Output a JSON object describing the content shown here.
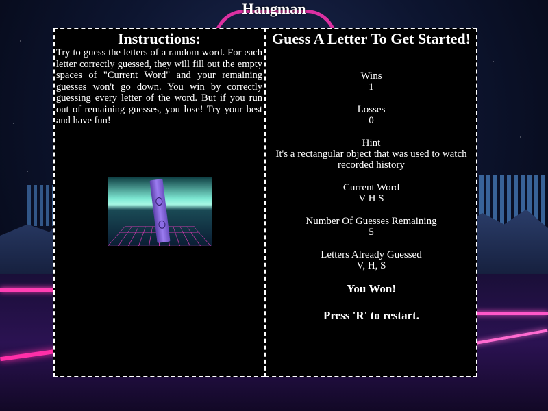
{
  "header": {
    "title": "Hangman"
  },
  "instructions": {
    "title": "Instructions:",
    "body": "Try to guess the letters of a random word. For each letter correctly guessed, they will fill out the empty spaces of \"Current Word\" and your remaining guesses won't go down. You win by correctly guessing every letter of the word. But if you run out of remaining guesses, you lose! Try your best and have fun!"
  },
  "game": {
    "title": "Guess A Letter To Get Started!",
    "wins_label": "Wins",
    "wins_value": "1",
    "losses_label": "Losses",
    "losses_value": "0",
    "hint_label": "Hint",
    "hint_value": "It's a rectangular object that was used to watch recorded history",
    "current_word_label": "Current Word",
    "current_word_value": "V H S",
    "guesses_remaining_label": "Number Of Guesses Remaining",
    "guesses_remaining_value": "5",
    "letters_guessed_label": "Letters Already Guessed",
    "letters_guessed_value": "V, H, S",
    "result_message": "You Won!",
    "restart_message": "Press 'R' to restart."
  },
  "colors": {
    "panel_bg": "#000000",
    "text": "#ffffff",
    "neon_pink": "#ff3fb4",
    "neon_cyan": "#7fe9d4"
  }
}
